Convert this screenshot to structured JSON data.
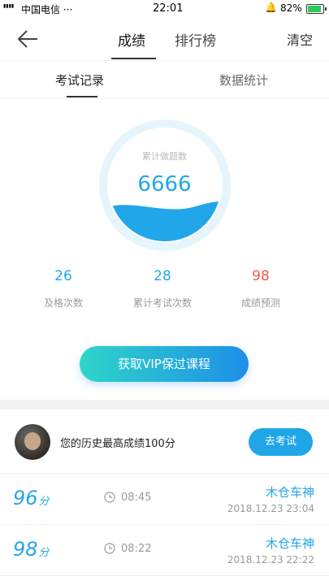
{
  "status": {
    "carrier": "中国电信 ···",
    "time": "22:01",
    "battery": "82%"
  },
  "nav": {
    "tab_scores": "成绩",
    "tab_rank": "排行榜",
    "clear": "清空"
  },
  "subtabs": {
    "records": "考试记录",
    "stats": "数据统计"
  },
  "gauge": {
    "label": "累计做题数",
    "value": "6666"
  },
  "stats": [
    {
      "value": "26",
      "label": "及格次数"
    },
    {
      "value": "28",
      "label": "累计考试次数"
    },
    {
      "value": "98",
      "label": "成绩预测"
    }
  ],
  "vip_button": "获取VIP保过课程",
  "best": {
    "text": "您的历史最高成绩100分",
    "go_label": "去考试"
  },
  "records": [
    {
      "score": "96",
      "unit": "分",
      "time": "08:45",
      "name": "木仓车神",
      "date": "2018.12.23  23:04"
    },
    {
      "score": "98",
      "unit": "分",
      "time": "08:22",
      "name": "木仓车神",
      "date": "2018.12.23  22:22"
    }
  ],
  "colors": {
    "accent": "#23a6e6",
    "predict": "#ef5a4a",
    "btn_start": "#2fd5c8",
    "btn_end": "#1e8fe8"
  }
}
